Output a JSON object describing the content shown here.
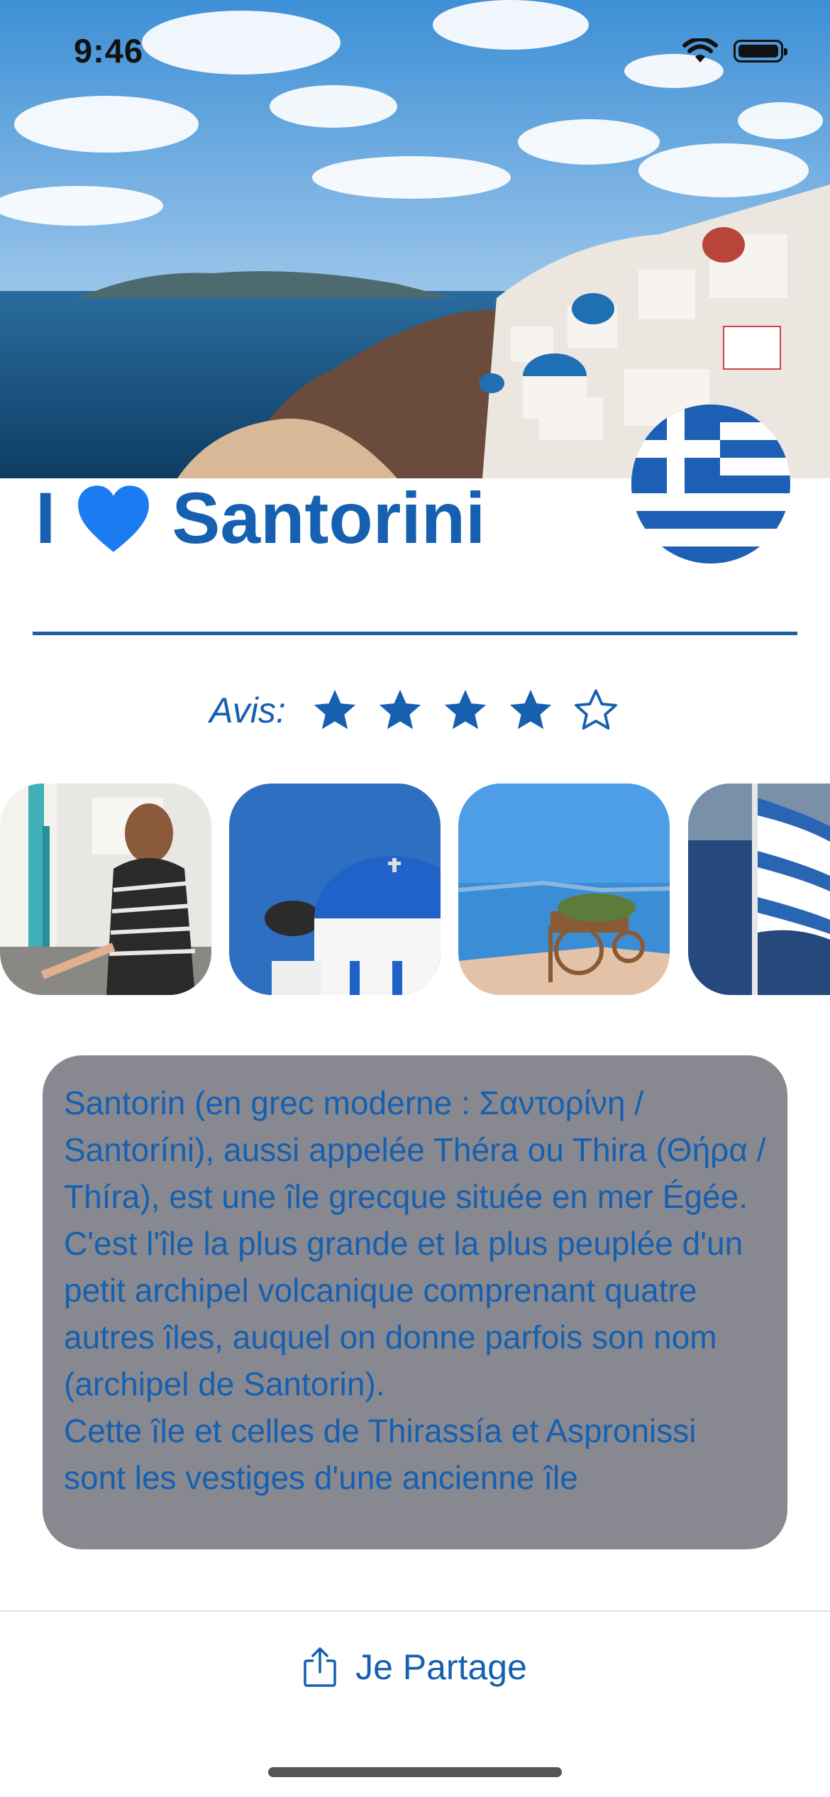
{
  "status_bar": {
    "time": "9:46"
  },
  "header": {
    "title": "Santorini",
    "title_prefix": "I",
    "heart_icon": "blue-heart-emoji",
    "flag_icon": "greek-flag"
  },
  "rating": {
    "label": "Avis:",
    "value": 4,
    "max": 5
  },
  "gallery": {
    "photos": [
      {
        "name": "woman-stairs-photo"
      },
      {
        "name": "blue-dome-church-photo"
      },
      {
        "name": "flower-cart-terrace-photo"
      },
      {
        "name": "greek-flag-photo"
      }
    ]
  },
  "description": {
    "text": "Santorin (en grec moderne : Σαντορίνη / Santoríni), aussi appelée Théra ou Thira (Θήρα / Thíra), est une île grecque située en mer Égée. C'est l'île la plus grande et la plus peuplée d'un petit archipel volcanique comprenant quatre autres îles, auquel on donne parfois son nom (archipel de Santorin).\nCette île et celles de Thirassía et Aspronissi sont les vestiges d'une ancienne île"
  },
  "share": {
    "label": "Je Partage",
    "icon": "share-icon"
  },
  "colors": {
    "accent": "#1560b0",
    "description_bg": "#888890",
    "flag_blue": "#1d5fb4"
  }
}
